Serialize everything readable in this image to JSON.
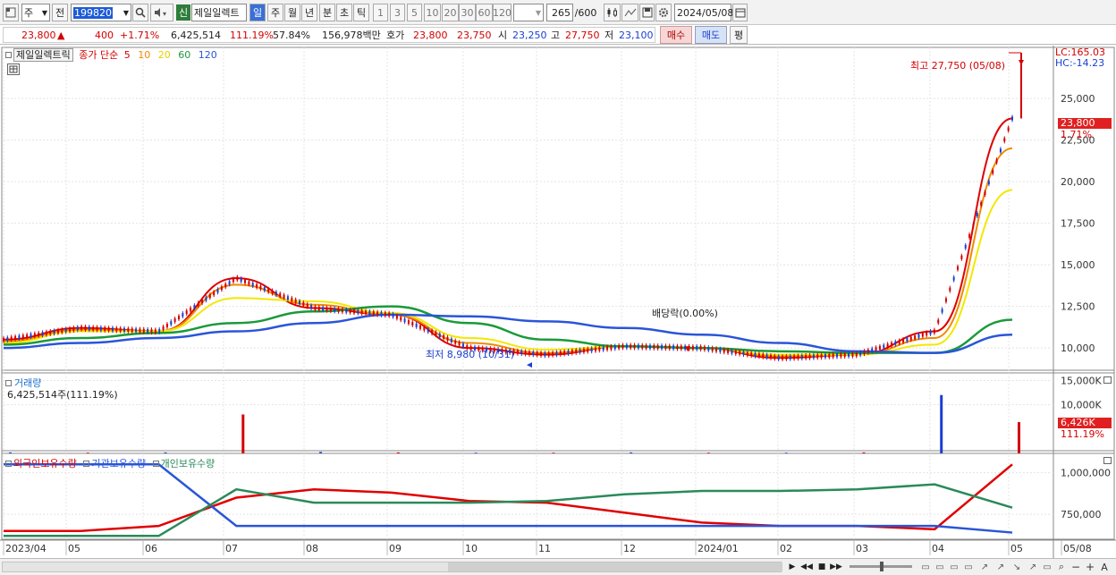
{
  "toolbar": {
    "period_type": "주",
    "prev_label": "전",
    "code": "199820",
    "new_badge": "신",
    "stock_name": "제일일렉트",
    "periods": [
      "일",
      "주",
      "월",
      "년",
      "분",
      "초",
      "틱"
    ],
    "active_period": "일",
    "intervals": [
      "1",
      "3",
      "5",
      "10",
      "20",
      "30",
      "60",
      "120"
    ],
    "count": "265",
    "count_max": "/600",
    "date": "2024/05/08"
  },
  "quote": {
    "price": "23,800",
    "arrow": "▲",
    "change": "400",
    "change_pct": "+1.71%",
    "volume": "6,425,514",
    "volume_ratio": "111.19%",
    "turnover_ratio": "57.84%",
    "amount": "156,978백만",
    "bid_label": "호가",
    "bid1": "23,800",
    "bid2": "23,750",
    "open_label": "시",
    "open": "23,250",
    "high_label": "고",
    "high": "27,750",
    "low_label": "저",
    "low": "23,100",
    "buy_label": "매수",
    "sell_label": "매도",
    "avg_label": "평"
  },
  "price_pane": {
    "name": "제일일렉트릭",
    "ma_label": "종가 단순",
    "ma_periods": [
      "5",
      "10",
      "20",
      "60",
      "120"
    ],
    "ma_colors": [
      "#e00000",
      "#f08a00",
      "#f2e800",
      "#1a9a3a",
      "#2a55d8"
    ],
    "lc": "LC:165.03",
    "hc": "HC:-14.23",
    "high_note": "최고 27,750 (05/08)",
    "low_note": "최저 8,980 (10/31)",
    "div_note": "배당락(0.00%)",
    "current_tag": "23,800",
    "current_pct": "1.71%"
  },
  "volume_pane": {
    "name": "거래량",
    "summary": "6,425,514주(111.19%)",
    "current_tag": "6,426K",
    "current_pct": "111.19%"
  },
  "holdings_pane": {
    "series": [
      "외국인보유수량",
      "기관보유수량",
      "개인보유수량"
    ],
    "colors": [
      "#e00000",
      "#2a55d8",
      "#2a8a5a"
    ]
  },
  "x_labels": [
    "2023/04",
    "05",
    "06",
    "07",
    "08",
    "09",
    "10",
    "11",
    "12",
    "2024/01",
    "02",
    "03",
    "04",
    "05",
    "05/08"
  ],
  "chart_data": [
    {
      "type": "line",
      "title": "제일일렉트릭",
      "ylim": [
        8500,
        27750
      ],
      "y_ticks": [
        "25,000",
        "22,500",
        "20,000",
        "17,500",
        "15,000",
        "12,500",
        "10,000"
      ],
      "x": [
        "2023/04",
        "05",
        "06",
        "07",
        "08",
        "09",
        "10",
        "11",
        "12",
        "2024/01",
        "02",
        "03",
        "04",
        "05"
      ],
      "series": [
        {
          "name": "5",
          "values": [
            10500,
            11200,
            11000,
            14200,
            12400,
            12000,
            10000,
            9600,
            10100,
            10000,
            9400,
            9600,
            11000,
            23800
          ]
        },
        {
          "name": "10",
          "values": [
            10400,
            11100,
            11000,
            13800,
            12600,
            12000,
            10300,
            9700,
            10100,
            10000,
            9500,
            9600,
            10600,
            22000
          ]
        },
        {
          "name": "20",
          "values": [
            10300,
            11000,
            11000,
            13000,
            12800,
            12100,
            10600,
            9900,
            10100,
            10000,
            9600,
            9600,
            10200,
            19500
          ]
        },
        {
          "name": "60",
          "values": [
            10200,
            10600,
            10900,
            11500,
            12200,
            12500,
            11500,
            10500,
            10100,
            10000,
            9800,
            9700,
            9700,
            11700
          ]
        },
        {
          "name": "120",
          "values": [
            10000,
            10300,
            10600,
            11000,
            11500,
            12000,
            11900,
            11600,
            11200,
            10800,
            10300,
            9800,
            9700,
            10800
          ]
        }
      ],
      "annotations": [
        "최고 27,750 (05/08)",
        "최저 8,980 (10/31)",
        "배당락(0.00%)"
      ]
    },
    {
      "type": "bar",
      "title": "거래량",
      "y_ticks": [
        "15,000K",
        "10,000K"
      ],
      "ylim": [
        0,
        16000
      ],
      "x": [
        "2023/04",
        "05",
        "06",
        "07",
        "08",
        "09",
        "10",
        "11",
        "12",
        "2024/01",
        "02",
        "03",
        "04",
        "05"
      ],
      "values": [
        200,
        150,
        200,
        8000,
        300,
        200,
        150,
        150,
        200,
        150,
        150,
        200,
        12000,
        6426
      ]
    },
    {
      "type": "line",
      "title": "보유수량",
      "y_ticks": [
        "1,000,000",
        "750,000"
      ],
      "ylim": [
        600000,
        1100000
      ],
      "x": [
        "2023/04",
        "05",
        "06",
        "07",
        "08",
        "09",
        "10",
        "11",
        "12",
        "2024/01",
        "02",
        "03",
        "04",
        "05"
      ],
      "series": [
        {
          "name": "외국인보유수량",
          "values": [
            650000,
            650000,
            680000,
            850000,
            900000,
            880000,
            830000,
            820000,
            760000,
            700000,
            680000,
            680000,
            660000,
            1050000
          ]
        },
        {
          "name": "기관보유수량",
          "values": [
            1050000,
            1050000,
            1050000,
            680000,
            680000,
            680000,
            680000,
            680000,
            680000,
            680000,
            680000,
            680000,
            680000,
            640000
          ]
        },
        {
          "name": "개인보유수량",
          "values": [
            620000,
            620000,
            620000,
            900000,
            820000,
            820000,
            820000,
            830000,
            870000,
            890000,
            890000,
            900000,
            930000,
            790000
          ]
        }
      ]
    }
  ]
}
